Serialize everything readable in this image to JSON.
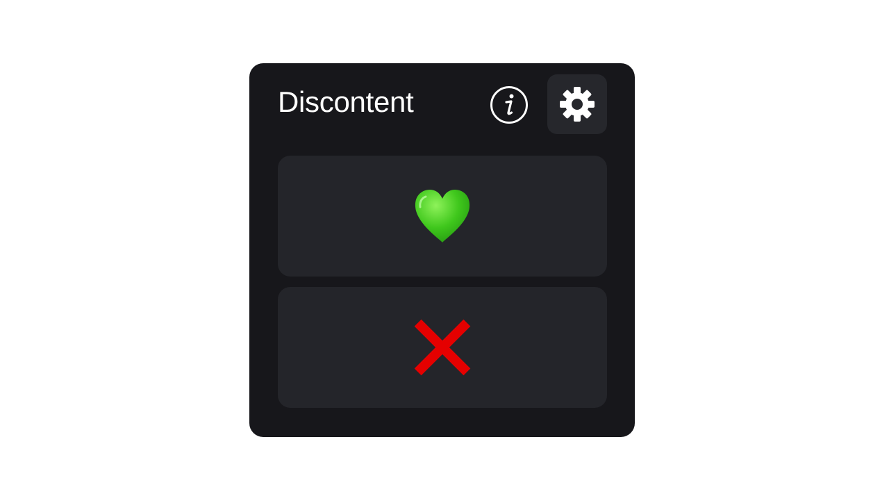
{
  "app": {
    "title": "Discontent"
  },
  "header": {
    "info_icon": "info-icon",
    "settings_icon": "gear-icon"
  },
  "choices": [
    {
      "icon": "green-heart-icon",
      "color": "#3bbf1a"
    },
    {
      "icon": "red-cross-icon",
      "color": "#e50000"
    }
  ],
  "colors": {
    "panel_background": "#17171b",
    "button_background": "#24252a",
    "settings_background": "#26272c",
    "text": "#ffffff"
  }
}
